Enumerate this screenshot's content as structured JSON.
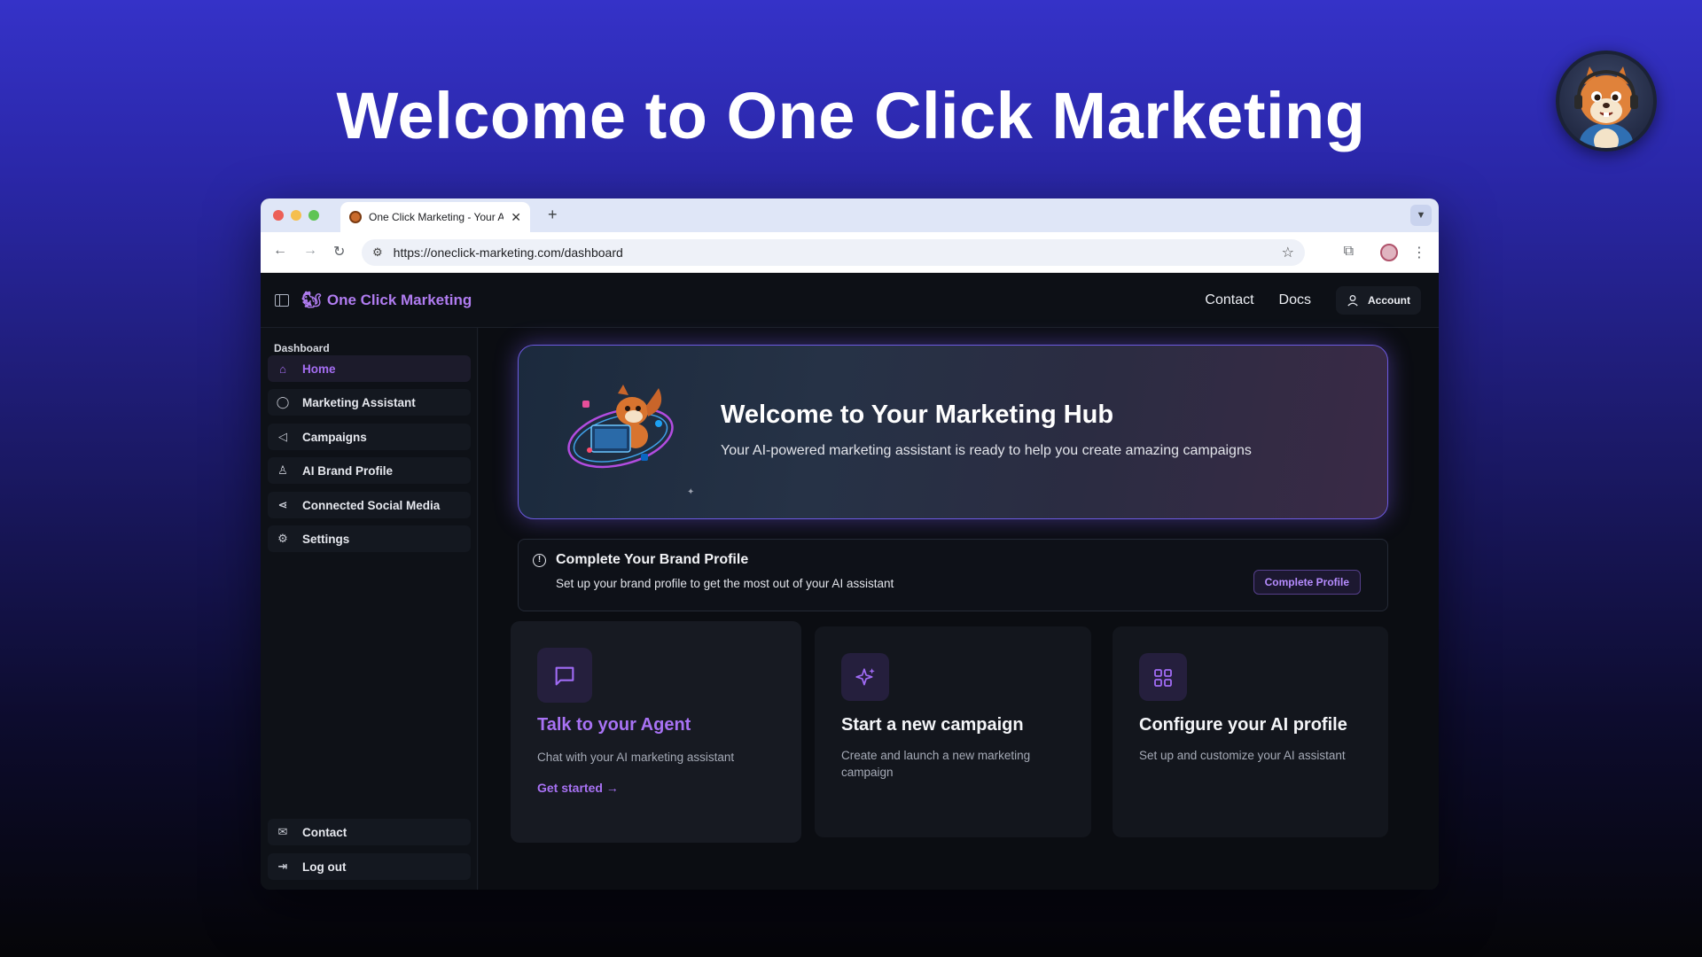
{
  "hero": {
    "title": "Welcome to One Click Marketing"
  },
  "browser": {
    "tab_title": "One Click Marketing - Your AI",
    "tab_close": "✕",
    "new_tab": "+",
    "url": "https://oneclick-marketing.com/dashboard"
  },
  "app": {
    "brand": "One Click Marketing",
    "nav": {
      "contact": "Contact",
      "docs": "Docs",
      "account": "Account"
    }
  },
  "sidebar": {
    "section": "Dashboard",
    "items": [
      {
        "label": "Home",
        "icon": "home-icon",
        "active": true
      },
      {
        "label": "Marketing Assistant",
        "icon": "chat-icon"
      },
      {
        "label": "Campaigns",
        "icon": "megaphone-icon"
      },
      {
        "label": "AI Brand Profile",
        "icon": "user-icon"
      },
      {
        "label": "Connected Social Media",
        "icon": "share-icon"
      },
      {
        "label": "Settings",
        "icon": "gear-icon"
      }
    ],
    "footer": [
      {
        "label": "Contact",
        "icon": "mail-icon"
      },
      {
        "label": "Log out",
        "icon": "logout-icon"
      }
    ]
  },
  "main": {
    "banner": {
      "title": "Welcome to Your Marketing Hub",
      "subtitle": "Your AI-powered marketing assistant is ready to help you create amazing campaigns"
    },
    "alert": {
      "title": "Complete Your Brand Profile",
      "description": "Set up your brand profile to get the most out of your AI assistant",
      "button": "Complete Profile"
    },
    "cards": [
      {
        "title": "Talk to your Agent",
        "description": "Chat with your AI marketing assistant",
        "link": "Get started →",
        "icon": "message-square-icon"
      },
      {
        "title": "Start a new campaign",
        "description": "Create and launch a new marketing campaign",
        "icon": "sparkles-icon"
      },
      {
        "title": "Configure your AI profile",
        "description": "Set up and customize your AI assistant",
        "icon": "grid-icon"
      }
    ]
  },
  "colors": {
    "accent": "#a872f4",
    "background_top": "#3532c8",
    "app_bg": "#0d1016"
  }
}
